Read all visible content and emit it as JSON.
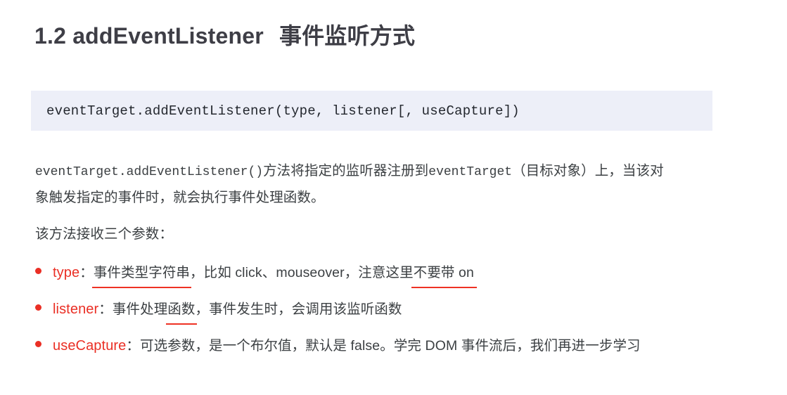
{
  "document": {
    "heading": {
      "number": "1.2",
      "name": "addEventListener",
      "cjk": "事件监听方式",
      "full": "1.2 addEventListener 事件监听方式"
    },
    "code_block": {
      "language": "javascript",
      "background_color": "#edeff8",
      "text": "eventTarget.addEventListener(type, listener[, useCapture])"
    },
    "paragraph_1": {
      "line_1_code": "eventTarget.addEventListener()",
      "line_1_text": "方法将指定的监听器注册到",
      "line_1_code_2": "eventTarget",
      "line_1_text_2": "（目标对象）上，当该对",
      "line_2": "象触发指定的事件时，就会执行事件处理函数。"
    },
    "paragraph_2": "该方法接收三个参数：",
    "params": [
      {
        "name": "type",
        "separator": "：",
        "text_before": "事件类型字符串",
        "underline_1": "",
        "text_mid": "，比如 click、mouseover，注意这里",
        "underline_2": "不要带 on",
        "text_after": "",
        "full": "type：事件类型字符串，比如 click、mouseover，注意这里不要带 on",
        "underlined_segments": [
          "字符串",
          "不要带 on"
        ]
      },
      {
        "name": "listener",
        "separator": "：",
        "text_before": "事件处理",
        "underline_1": "函数",
        "text_after": "，事件发生时，会调用该监听函数",
        "full": "listener：事件处理函数，事件发生时，会调用该监听函数",
        "underlined_segments": [
          "函数"
        ]
      },
      {
        "name": "useCapture",
        "separator": "：",
        "text_before": "可选参数，是一个布尔值，默认是 false。学完 DOM 事件流后，我们再进一步学习",
        "full": "useCapture：可选参数，是一个布尔值，默认是 false。学完 DOM 事件流后，我们再进一步学习",
        "underlined_segments": []
      }
    ],
    "colors": {
      "accent_red": "#ea2f25",
      "underline_red": "#ee3224",
      "heading": "#3e3e46",
      "body_text": "#3c4043",
      "code_background": "#edeff8",
      "page_background": "#ffffff"
    }
  }
}
